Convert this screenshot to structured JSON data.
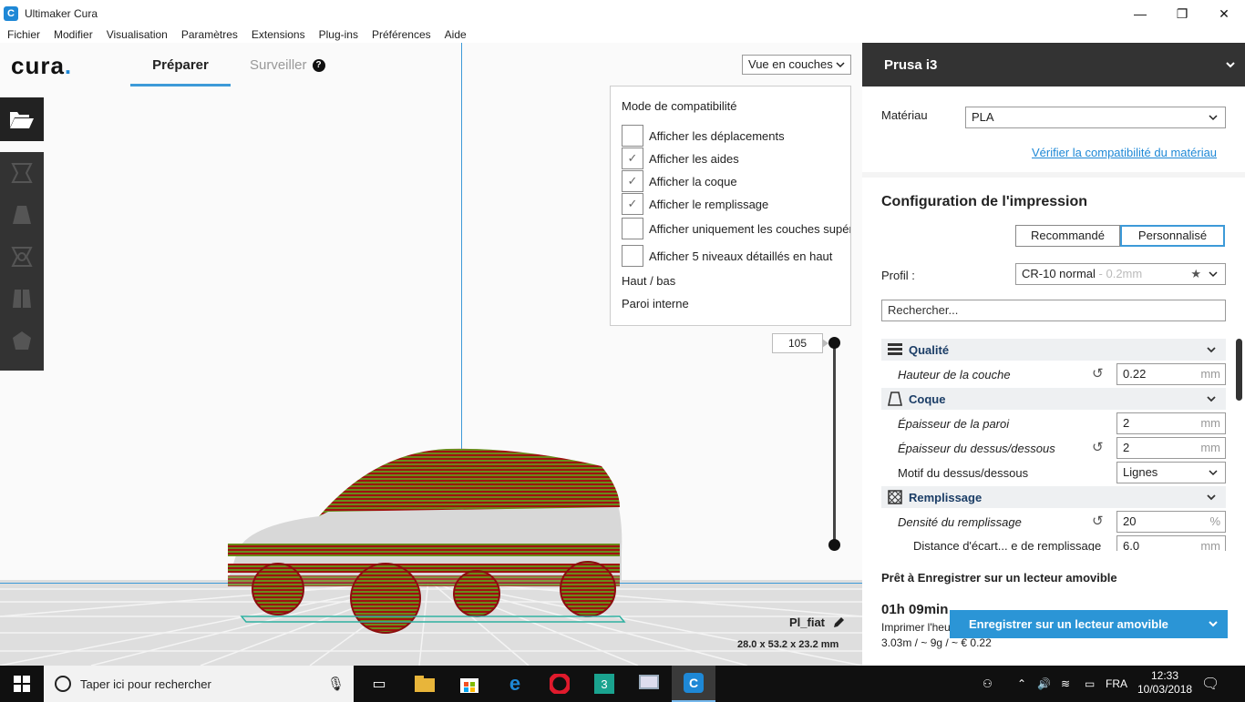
{
  "window": {
    "title": "Ultimaker Cura",
    "minimize": "—",
    "maximize": "❐",
    "close": "✕"
  },
  "menu": [
    "Fichier",
    "Modifier",
    "Visualisation",
    "Paramètres",
    "Extensions",
    "Plug-ins",
    "Préférences",
    "Aide"
  ],
  "header": {
    "logo": "cura",
    "logo_dot": ".",
    "tab_prepare": "Préparer",
    "tab_monitor": "Surveiller",
    "help": "?"
  },
  "view_select": {
    "value": "Vue en couches"
  },
  "layer_panel": {
    "mode": "Mode de compatibilité",
    "checkboxes": [
      {
        "label": "Afficher les déplacements",
        "checked": false
      },
      {
        "label": "Afficher les aides",
        "checked": true
      },
      {
        "label": "Afficher la coque",
        "checked": true
      },
      {
        "label": "Afficher le remplissage",
        "checked": true
      },
      {
        "label": "Afficher uniquement les couches supérieures",
        "checked": false
      },
      {
        "label": "Afficher 5 niveaux détaillés en haut",
        "checked": false
      }
    ],
    "check_mark": "✓",
    "top_bottom": "Haut / bas",
    "inner_wall": "Paroi interne"
  },
  "layer_slider": {
    "current": "105"
  },
  "model": {
    "name": "Pl_fiat",
    "dimensions": "28.0 x 53.2 x 23.2 mm"
  },
  "printer": {
    "name": "Prusa i3"
  },
  "material": {
    "label": "Matériau",
    "value": "PLA",
    "link": "Vérifier la compatibilité du matériau"
  },
  "print_setup": {
    "title": "Configuration de l'impression",
    "recommended": "Recommandé",
    "custom": "Personnalisé",
    "profile_label": "Profil :",
    "profile_value": "CR-10 normal",
    "profile_suffix": " - 0.2mm",
    "search_placeholder": "Rechercher..."
  },
  "settings": {
    "quality": {
      "title": "Qualité",
      "layer_height_label": "Hauteur de la couche",
      "layer_height_value": "0.22",
      "layer_height_unit": "mm"
    },
    "shell": {
      "title": "Coque",
      "wall_thickness_label": "Épaisseur de la paroi",
      "wall_thickness_value": "2",
      "wall_thickness_unit": "mm",
      "topbottom_thickness_label": "Épaisseur du dessus/dessous",
      "topbottom_thickness_value": "2",
      "topbottom_thickness_unit": "mm",
      "topbottom_pattern_label": "Motif du dessus/dessous",
      "topbottom_pattern_value": "Lignes"
    },
    "infill": {
      "title": "Remplissage",
      "density_label": "Densité du remplissage",
      "density_value": "20",
      "density_unit": "%",
      "line_distance_label": "Distance d'écart... e de remplissage",
      "line_distance_value": "6.0",
      "line_distance_unit": "mm"
    }
  },
  "ready": {
    "title": "Prêt à Enregistrer sur un lecteur amovible",
    "time": "01h 09min",
    "print_label": "Imprimer l'heure",
    "cost": "3.03m / ~ 9g / ~ € 0.22",
    "save_button": "Enregistrer sur un lecteur amovible"
  },
  "taskbar": {
    "search_placeholder": "Taper ici pour rechercher",
    "language": "FRA",
    "time": "12:33",
    "date": "10/03/2018"
  },
  "colors": {
    "accent": "#3d9ad8",
    "dark_header": "#333333",
    "save_button": "#2b95d6",
    "model_red": "#a01010",
    "model_green": "#6a8a1a"
  }
}
